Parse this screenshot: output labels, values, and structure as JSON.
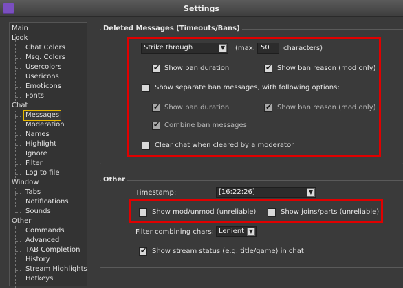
{
  "window": {
    "title": "Settings"
  },
  "sidebar": {
    "items": [
      "Main",
      "Look",
      "Chat Colors",
      "Msg. Colors",
      "Usercolors",
      "Usericons",
      "Emoticons",
      "Fonts",
      "Chat",
      "Messages",
      "Moderation",
      "Names",
      "Highlight",
      "Ignore",
      "Filter",
      "Log to file",
      "Window",
      "Tabs",
      "Notifications",
      "Sounds",
      "Other",
      "Commands",
      "Advanced",
      "TAB Completion",
      "History",
      "Stream Highlights",
      "Hotkeys"
    ],
    "selected": "Messages"
  },
  "deleted_messages": {
    "group_title": "Deleted Messages (Timeouts/Bans)",
    "mode_value": "Strike through",
    "max_prefix": "(max.",
    "max_value": "50",
    "max_suffix": "characters)",
    "show_ban_duration": "Show ban duration",
    "show_ban_reason": "Show ban reason (mod only)",
    "separate_ban_messages": "Show separate ban messages, with following options:",
    "sep_show_ban_duration": "Show ban duration",
    "sep_show_ban_reason": "Show ban reason (mod only)",
    "combine_ban_messages": "Combine ban messages",
    "clear_chat_label": "Clear chat when cleared by a moderator"
  },
  "other": {
    "group_title": "Other",
    "timestamp_label": "Timestamp:",
    "timestamp_value": "[16:22:26]",
    "show_mod_unmod": "Show mod/unmod (unreliable)",
    "show_joins_parts": "Show joins/parts (unreliable)",
    "filter_label": "Filter combining chars:",
    "filter_value": "Lenient",
    "show_stream_status": "Show stream status (e.g. title/game) in chat"
  },
  "colors": {
    "highlight_box": "#e00000",
    "selection_outline": "#e6b800"
  }
}
